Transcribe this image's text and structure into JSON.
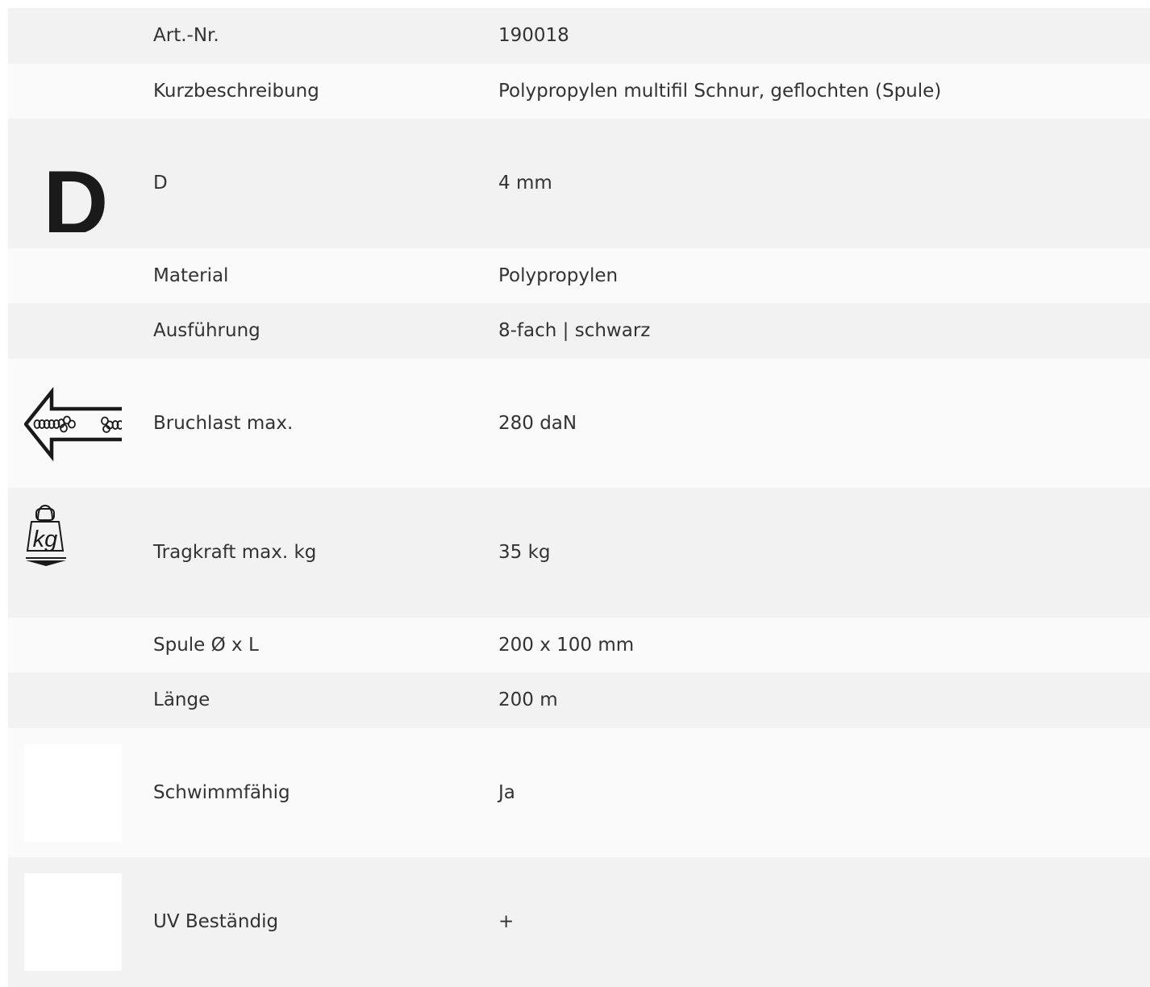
{
  "rows": [
    {
      "label": "Art.-Nr.",
      "value": "190018"
    },
    {
      "label": "Kurzbeschreibung",
      "value": "Polypropylen multifil Schnur, geflochten (Spule)"
    },
    {
      "label": "D",
      "value": "4 mm",
      "icon": "diameter-d-icon"
    },
    {
      "label": "Material",
      "value": "Polypropylen"
    },
    {
      "label": "Ausführung",
      "value": "8-fach | schwarz"
    },
    {
      "label": "Bruchlast max.",
      "value": "280 daN",
      "icon": "breaking-load-arrow-icon"
    },
    {
      "label": "Tragkraft max. kg",
      "value": "35 kg",
      "icon": "weight-kg-icon"
    },
    {
      "label": "Spule Ø x L",
      "value": "200 x 100 mm"
    },
    {
      "label": "Länge",
      "value": "200 m"
    },
    {
      "label": "Schwimmfähig",
      "value": "Ja",
      "icon": "blank-icon"
    },
    {
      "label": "UV Beständig",
      "value": "+",
      "icon": "blank-icon"
    }
  ],
  "icons": {
    "d_letter": "D",
    "kg_letters": "kg"
  },
  "colors": {
    "row_shade": "#f2f2f2",
    "row_plain": "#fafafa",
    "text": "#333333",
    "icon": "#1a1a1a"
  }
}
